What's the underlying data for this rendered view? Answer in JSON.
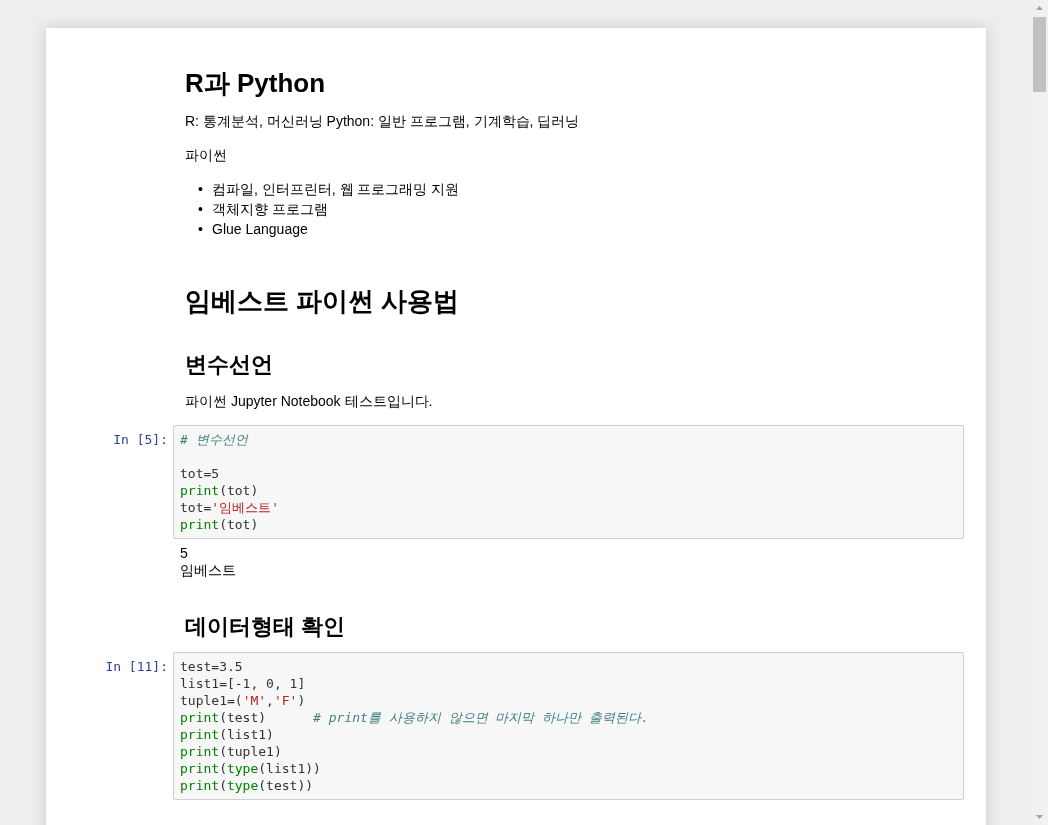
{
  "cells": [
    {
      "kind": "heading1",
      "text": "R과 Python"
    },
    {
      "kind": "paragraph",
      "text": "R: 통계분석, 머신러닝 Python: 일반 프로그램, 기계학습, 딥러닝"
    },
    {
      "kind": "paragraph",
      "text": "파이썬"
    },
    {
      "kind": "bullets",
      "items": [
        {
          "marker": "•",
          "text": "컴파일, 인터프린터, 웹 프로그래밍 지원"
        },
        {
          "marker": "•",
          "text": "객체지향 프로그램"
        },
        {
          "marker": "•",
          "text": "Glue Language"
        }
      ]
    },
    {
      "kind": "heading1",
      "text": "임베스트 파이썬 사용법"
    },
    {
      "kind": "heading2",
      "text": "변수선언"
    },
    {
      "kind": "paragraph",
      "text": "파이썬 Jupyter Notebook 테스트입니다."
    },
    {
      "kind": "code",
      "prompt": "In [5]:",
      "lines": [
        {
          "kind": "code",
          "tokens": [
            {
              "kind": "comment",
              "text": "# 변수선언"
            }
          ]
        },
        {
          "kind": "blank"
        },
        {
          "kind": "code",
          "tokens": [
            {
              "kind": "plain",
              "text": "tot=5"
            }
          ]
        },
        {
          "kind": "code",
          "tokens": [
            {
              "kind": "builtin",
              "text": "print"
            },
            {
              "kind": "plain",
              "text": "(tot)"
            }
          ]
        },
        {
          "kind": "code",
          "tokens": [
            {
              "kind": "plain",
              "text": "tot="
            },
            {
              "kind": "string",
              "text": "'임베스트'"
            }
          ]
        },
        {
          "kind": "code",
          "tokens": [
            {
              "kind": "builtin",
              "text": "print"
            },
            {
              "kind": "plain",
              "text": "(tot)"
            }
          ]
        }
      ],
      "outputs": [
        "5",
        "임베스트"
      ]
    },
    {
      "kind": "heading2",
      "text": "데이터형태 확인"
    },
    {
      "kind": "code",
      "prompt": "In [11]:",
      "lines": [
        {
          "kind": "code",
          "tokens": [
            {
              "kind": "plain",
              "text": "test=3.5"
            }
          ]
        },
        {
          "kind": "code",
          "tokens": [
            {
              "kind": "plain",
              "text": "list1=[-1, 0, 1]"
            }
          ]
        },
        {
          "kind": "code",
          "tokens": [
            {
              "kind": "plain",
              "text": "tuple1=("
            },
            {
              "kind": "string",
              "text": "'M'"
            },
            {
              "kind": "plain",
              "text": ","
            },
            {
              "kind": "string",
              "text": "'F'"
            },
            {
              "kind": "plain",
              "text": ")"
            }
          ]
        },
        {
          "kind": "code",
          "tokens": [
            {
              "kind": "builtin",
              "text": "print"
            },
            {
              "kind": "plain",
              "text": "(test)      "
            },
            {
              "kind": "comment",
              "text": "# print를 사용하지 않으면 마지막 하나만 출력된다."
            }
          ]
        },
        {
          "kind": "code",
          "tokens": [
            {
              "kind": "builtin",
              "text": "print"
            },
            {
              "kind": "plain",
              "text": "(list1)"
            }
          ]
        },
        {
          "kind": "code",
          "tokens": [
            {
              "kind": "builtin",
              "text": "print"
            },
            {
              "kind": "plain",
              "text": "(tuple1)"
            }
          ]
        },
        {
          "kind": "code",
          "tokens": [
            {
              "kind": "builtin",
              "text": "print"
            },
            {
              "kind": "plain",
              "text": "("
            },
            {
              "kind": "builtin",
              "text": "type"
            },
            {
              "kind": "plain",
              "text": "(list1))"
            }
          ]
        },
        {
          "kind": "code",
          "tokens": [
            {
              "kind": "builtin",
              "text": "print"
            },
            {
              "kind": "plain",
              "text": "("
            },
            {
              "kind": "builtin",
              "text": "type"
            },
            {
              "kind": "plain",
              "text": "(test))"
            }
          ]
        }
      ]
    }
  ]
}
